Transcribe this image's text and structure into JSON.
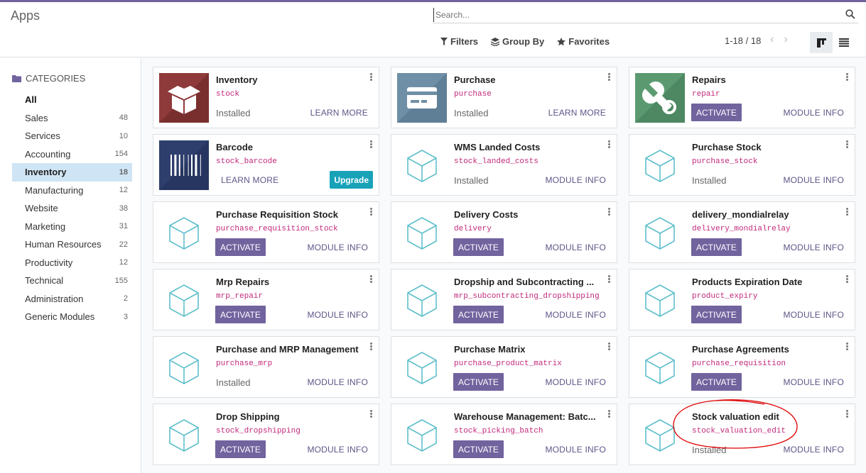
{
  "header": {
    "title": "Apps",
    "search_placeholder": "Search...",
    "filters_label": "Filters",
    "groupby_label": "Group By",
    "favorites_label": "Favorites",
    "pager": "1-18 / 18"
  },
  "sidebar": {
    "heading": "CATEGORIES",
    "items": [
      {
        "label": "All",
        "count": ""
      },
      {
        "label": "Sales",
        "count": "48"
      },
      {
        "label": "Services",
        "count": "10"
      },
      {
        "label": "Accounting",
        "count": "154"
      },
      {
        "label": "Inventory",
        "count": "18"
      },
      {
        "label": "Manufacturing",
        "count": "12"
      },
      {
        "label": "Website",
        "count": "38"
      },
      {
        "label": "Marketing",
        "count": "31"
      },
      {
        "label": "Human Resources",
        "count": "22"
      },
      {
        "label": "Productivity",
        "count": "12"
      },
      {
        "label": "Technical",
        "count": "155"
      },
      {
        "label": "Administration",
        "count": "2"
      },
      {
        "label": "Generic Modules",
        "count": "3"
      }
    ]
  },
  "apps": [
    {
      "name": "Inventory",
      "tech": "stock",
      "status": "Installed",
      "link": "LEARN MORE",
      "icon": "inventory-icon"
    },
    {
      "name": "Purchase",
      "tech": "purchase",
      "status": "Installed",
      "link": "LEARN MORE",
      "icon": "purchase-icon"
    },
    {
      "name": "Repairs",
      "tech": "repair",
      "activate": "ACTIVATE",
      "link": "MODULE INFO",
      "icon": "repairs-icon"
    },
    {
      "name": "Barcode",
      "tech": "stock_barcode",
      "link_left": "LEARN MORE",
      "upgrade": "Upgrade",
      "icon": "barcode-icon"
    },
    {
      "name": "WMS Landed Costs",
      "tech": "stock_landed_costs",
      "status": "Installed",
      "link": "MODULE INFO",
      "icon": "module-cube-icon"
    },
    {
      "name": "Purchase Stock",
      "tech": "purchase_stock",
      "status": "Installed",
      "link": "MODULE INFO",
      "icon": "module-cube-icon"
    },
    {
      "name": "Purchase Requisition Stock",
      "tech": "purchase_requisition_stock",
      "activate": "ACTIVATE",
      "link": "MODULE INFO",
      "icon": "module-cube-icon"
    },
    {
      "name": "Delivery Costs",
      "tech": "delivery",
      "activate": "ACTIVATE",
      "link": "MODULE INFO",
      "icon": "module-cube-icon"
    },
    {
      "name": "delivery_mondialrelay",
      "tech": "delivery_mondialrelay",
      "activate": "ACTIVATE",
      "link": "MODULE INFO",
      "icon": "module-cube-icon"
    },
    {
      "name": "Mrp Repairs",
      "tech": "mrp_repair",
      "activate": "ACTIVATE",
      "link": "MODULE INFO",
      "icon": "module-cube-icon"
    },
    {
      "name": "Dropship and Subcontracting ...",
      "tech": "mrp_subcontracting_dropshipping",
      "activate": "ACTIVATE",
      "link": "MODULE INFO",
      "icon": "module-cube-icon"
    },
    {
      "name": "Products Expiration Date",
      "tech": "product_expiry",
      "activate": "ACTIVATE",
      "link": "MODULE INFO",
      "icon": "module-cube-icon"
    },
    {
      "name": "Purchase and MRP Management",
      "tech": "purchase_mrp",
      "status": "Installed",
      "link": "MODULE INFO",
      "icon": "module-cube-icon"
    },
    {
      "name": "Purchase Matrix",
      "tech": "purchase_product_matrix",
      "activate": "ACTIVATE",
      "link": "MODULE INFO",
      "icon": "module-cube-icon"
    },
    {
      "name": "Purchase Agreements",
      "tech": "purchase_requisition",
      "activate": "ACTIVATE",
      "link": "MODULE INFO",
      "icon": "module-cube-icon"
    },
    {
      "name": "Drop Shipping",
      "tech": "stock_dropshipping",
      "activate": "ACTIVATE",
      "link": "MODULE INFO",
      "icon": "module-cube-icon"
    },
    {
      "name": "Warehouse Management: Batc...",
      "tech": "stock_picking_batch",
      "activate": "ACTIVATE",
      "link": "MODULE INFO",
      "icon": "module-cube-icon"
    },
    {
      "name": "Stock valuation edit",
      "tech": "stock_valuation_edit",
      "status": "Installed",
      "link": "MODULE INFO",
      "icon": "module-cube-icon"
    }
  ],
  "colors": {
    "accent": "#71639e",
    "tech": "#c1287a",
    "upgrade": "#17a2b8",
    "annotation": "#e00000"
  }
}
